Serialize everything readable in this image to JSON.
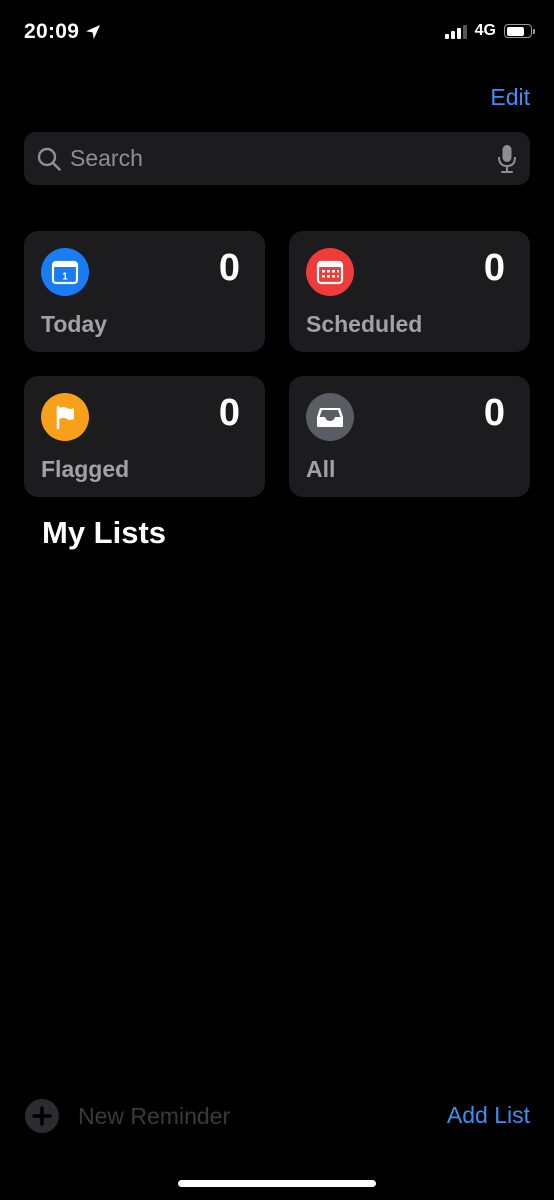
{
  "status_bar": {
    "time": "20:09",
    "network": "4G",
    "location_icon": "location-arrow-icon",
    "signal_bars_active": 3,
    "signal_bars_total": 4,
    "battery_level": 0.78
  },
  "header": {
    "edit_label": "Edit"
  },
  "search": {
    "placeholder": "Search",
    "value": "",
    "icon": "search-icon",
    "mic_icon": "microphone-icon"
  },
  "smart_lists": [
    {
      "label": "Today",
      "count": "0",
      "icon": "calendar-today-icon",
      "color": "#1a7cf2"
    },
    {
      "label": "Scheduled",
      "count": "0",
      "icon": "calendar-grid-icon",
      "color": "#ef3b39"
    },
    {
      "label": "Flagged",
      "count": "0",
      "icon": "flag-icon",
      "color": "#f8a01c"
    },
    {
      "label": "All",
      "count": "0",
      "icon": "tray-icon",
      "color": "#5a5d63"
    }
  ],
  "my_lists": {
    "title": "My Lists"
  },
  "toolbar": {
    "new_reminder_label": "New Reminder",
    "add_list_label": "Add List"
  },
  "colors": {
    "accent": "#3b8ff5",
    "background": "#000000",
    "card_background": "#1c1c1e"
  }
}
